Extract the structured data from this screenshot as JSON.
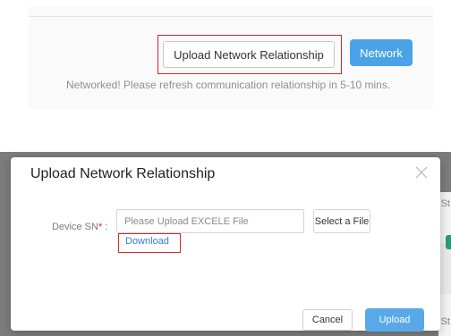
{
  "top_snippet": {
    "upload_button_label": "Upload Network Relationship",
    "network_button_label": "Network",
    "status_message": "Networked! Please refresh communication relationship in 5-10 mins."
  },
  "background": {
    "edge_text_1": "St",
    "edge_text_2": "St"
  },
  "modal": {
    "title": "Upload Network Relationship",
    "device_sn_label": "Device SN",
    "required_marker": "*",
    "label_suffix": " :",
    "file_placeholder": "Please Upload EXCELE File",
    "select_file_label": "Select a File",
    "download_label": "Download",
    "cancel_label": "Cancel",
    "upload_label": "Upload"
  },
  "colors": {
    "primary": "#4aa3e6",
    "highlight": "#d8262e",
    "link": "#3a7ad0"
  },
  "icons": {
    "close": "close-icon"
  }
}
